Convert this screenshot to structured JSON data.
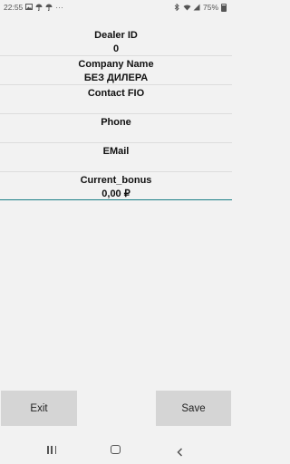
{
  "status_bar": {
    "time": "22:55",
    "left_icons": [
      "image-icon",
      "umbrella-icon",
      "umbrella-icon"
    ],
    "more": "···",
    "right_icons": [
      "bluetooth-icon",
      "wifi-icon",
      "signal-icon"
    ],
    "battery": "75%"
  },
  "form": {
    "dealer_id": {
      "label": "Dealer ID",
      "value": "0"
    },
    "company_name": {
      "label": "Company Name",
      "value": "БЕЗ ДИЛЕРА"
    },
    "contact_fio": {
      "label": "Contact FIO",
      "value": ""
    },
    "phone": {
      "label": "Phone",
      "value": ""
    },
    "email": {
      "label": "EMail",
      "value": ""
    },
    "current_bonus": {
      "label": "Current_bonus",
      "value": "0,00 ₽"
    }
  },
  "buttons": {
    "exit": "Exit",
    "save": "Save"
  },
  "navbar": [
    "recents-icon",
    "home-icon",
    "back-icon"
  ]
}
